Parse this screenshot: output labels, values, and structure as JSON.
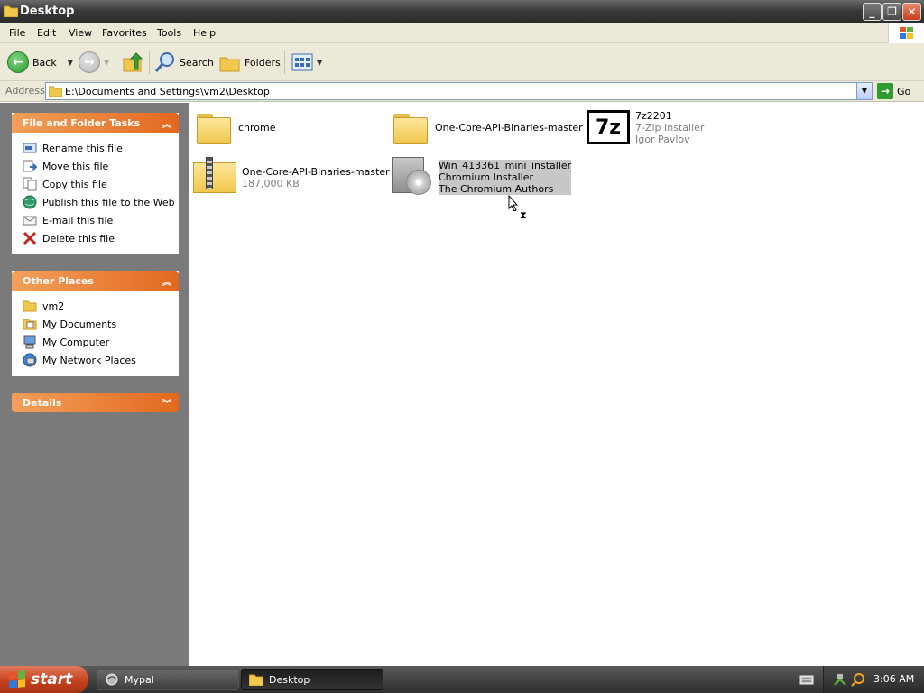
{
  "window": {
    "title": "Desktop",
    "folder_icon": "folder-icon",
    "buttons": {
      "minimize": "_",
      "restore": "❐",
      "close": "✕"
    }
  },
  "menu": [
    "File",
    "Edit",
    "View",
    "Favorites",
    "Tools",
    "Help"
  ],
  "toolbar": {
    "back_label": "Back",
    "search_label": "Search",
    "folders_label": "Folders"
  },
  "address": {
    "label": "Address",
    "value": "E:\\Documents and Settings\\vm2\\Desktop",
    "go_label": "Go"
  },
  "left_pane": {
    "file_tasks": {
      "title": "File and Folder Tasks",
      "items": [
        {
          "label": "Rename this file",
          "icon": "rename-icon"
        },
        {
          "label": "Move this file",
          "icon": "move-icon"
        },
        {
          "label": "Copy this file",
          "icon": "copy-icon"
        },
        {
          "label": "Publish this file to the Web",
          "icon": "globe-icon"
        },
        {
          "label": "E-mail this file",
          "icon": "email-icon"
        },
        {
          "label": "Delete this file",
          "icon": "delete-icon"
        }
      ]
    },
    "other_places": {
      "title": "Other Places",
      "items": [
        {
          "label": "vm2",
          "icon": "folder-icon"
        },
        {
          "label": "My Documents",
          "icon": "my-documents-icon"
        },
        {
          "label": "My Computer",
          "icon": "my-computer-icon"
        },
        {
          "label": "My Network Places",
          "icon": "network-icon"
        }
      ]
    },
    "details": {
      "title": "Details"
    }
  },
  "files": [
    {
      "name": "chrome",
      "type": "folder"
    },
    {
      "name": "One-Core-API-Binaries-master",
      "type": "folder"
    },
    {
      "name": "7z2201",
      "line2": "7-Zip Installer",
      "line3": "Igor Pavlov",
      "type": "installer-7z"
    },
    {
      "name": "One-Core-API-Binaries-master",
      "line2": "187,000 KB",
      "type": "zip"
    },
    {
      "name": "Win_413361_mini_installer",
      "line2": "Chromium Installer",
      "line3": "The Chromium Authors",
      "type": "installer",
      "selected": true
    }
  ],
  "taskbar": {
    "start_label": "start",
    "tasks": [
      {
        "label": "Mypal",
        "active": false
      },
      {
        "label": "Desktop",
        "active": true
      }
    ],
    "clock": "3:06 AM"
  },
  "colors": {
    "panel_header": "#e2681f",
    "left_pane_bg": "#7a7a7a",
    "selection": "#c7c7c7"
  }
}
